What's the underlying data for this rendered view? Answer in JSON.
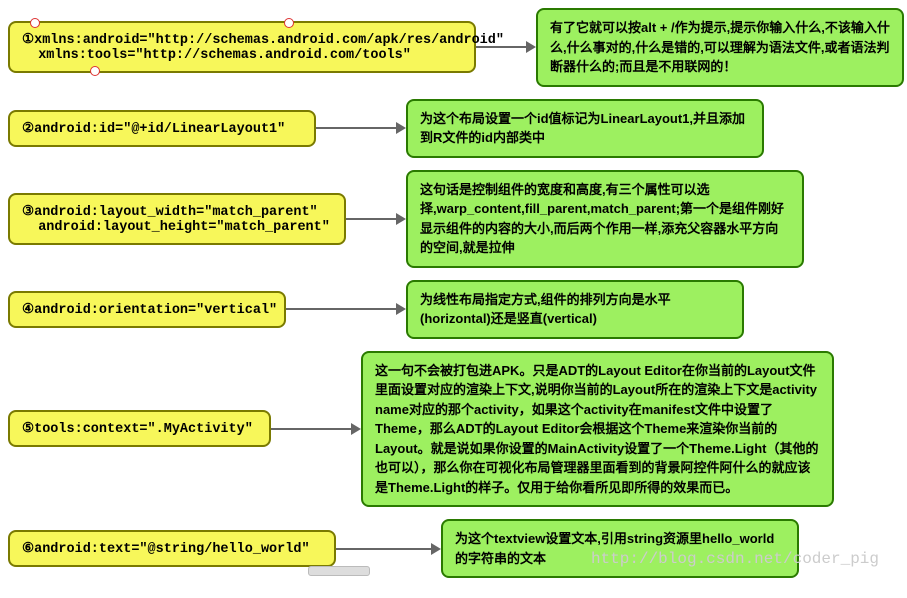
{
  "rows": [
    {
      "code": "①xmlns:android=\"http://schemas.android.com/apk/res/android\"\n  xmlns:tools=\"http://schemas.android.com/tools\"",
      "desc": "有了它就可以按alt + /作为提示,提示你输入什么,不该输入什么,什么事对的,什么是错的,可以理解为语法文件,或者语法判断器什么的;而且是不用联网的！",
      "leftWidth": 440,
      "gap": 50,
      "rightWidth": 340,
      "handles": true
    },
    {
      "code": "②android:id=\"@+id/LinearLayout1\"",
      "desc": "为这个布局设置一个id值标记为LinearLayout1,并且添加到R文件的id内部类中",
      "leftWidth": 280,
      "gap": 80,
      "rightWidth": 330
    },
    {
      "code": "③android:layout_width=\"match_parent\"\n  android:layout_height=\"match_parent\"",
      "desc": "这句话是控制组件的宽度和高度,有三个属性可以选择,warp_content,fill_parent,match_parent;第一个是组件刚好显示组件的内容的大小,而后两个作用一样,添充父容器水平方向的空间,就是拉伸",
      "leftWidth": 310,
      "gap": 50,
      "rightWidth": 370
    },
    {
      "code": "④android:orientation=\"vertical\"",
      "desc": "为线性布局指定方式,组件的排列方向是水平(horizontal)还是竖直(vertical)",
      "leftWidth": 250,
      "gap": 110,
      "rightWidth": 310
    },
    {
      "code": "⑤tools:context=\".MyActivity\"",
      "desc": "这一句不会被打包进APK。只是ADT的Layout Editor在你当前的Layout文件里面设置对应的渲染上下文,说明你当前的Layout所在的渲染上下文是activity name对应的那个activity，如果这个activity在manifest文件中设置了Theme，那么ADT的Layout Editor会根据这个Theme来渲染你当前的Layout。就是说如果你设置的MainActivity设置了一个Theme.Light（其他的也可以），那么你在可视化布局管理器里面看到的背景阿控件阿什么的就应该是Theme.Light的样子。仅用于给你看所见即所得的效果而已。",
      "leftWidth": 235,
      "gap": 80,
      "rightWidth": 445
    },
    {
      "code": "⑥android:text=\"@string/hello_world\"",
      "desc": "为这个textview设置文本,引用string资源里hello_world的字符串的文本",
      "leftWidth": 300,
      "gap": 95,
      "rightWidth": 330
    }
  ],
  "watermark": "http://blog.csdn.net/coder_pig"
}
